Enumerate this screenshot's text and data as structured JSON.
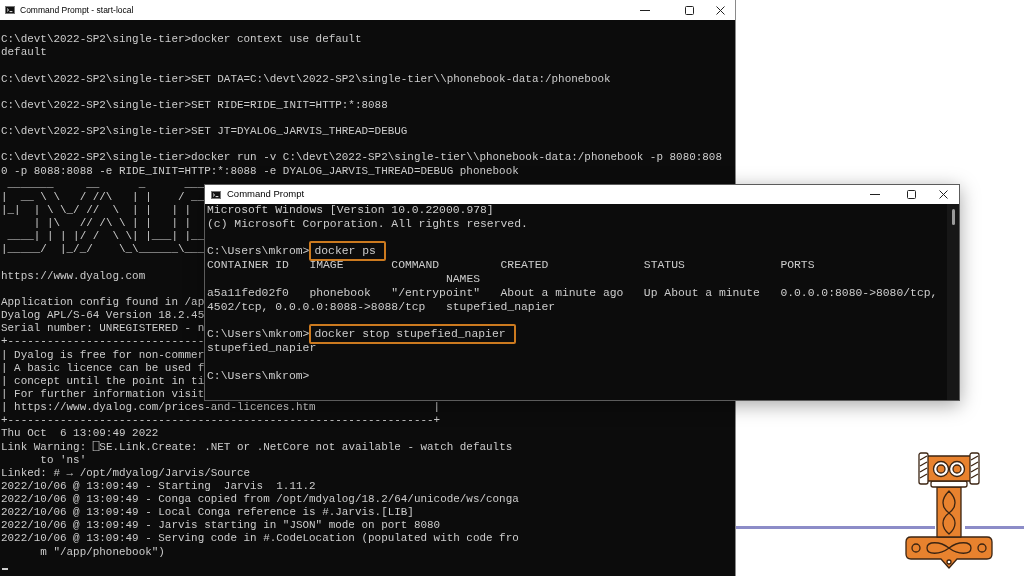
{
  "back_window": {
    "title": "Command Prompt - start-local",
    "cursor": true,
    "blocks": [
      [
        "C:\\devt\\2022-SP2\\single-tier>docker context use default",
        "default"
      ],
      [
        "C:\\devt\\2022-SP2\\single-tier>SET DATA=C:\\devt\\2022-SP2\\single-tier\\\\phonebook-data:/phonebook"
      ],
      [
        "C:\\devt\\2022-SP2\\single-tier>SET RIDE=RIDE_INIT=HTTP:*:8088"
      ],
      [
        "C:\\devt\\2022-SP2\\single-tier>SET JT=DYALOG_JARVIS_THREAD=DEBUG"
      ],
      [
        "C:\\devt\\2022-SP2\\single-tier>docker run -v C:\\devt\\2022-SP2\\single-tier\\\\phonebook-data:/phonebook -p 8080:808",
        "0 -p 8088:8088 -e RIDE_INIT=HTTP:*:8088 -e DYALOG_JARVIS_THREAD=DEBUG phonebook",
        " _______     __      _      ___",
        "|  __ \\ \\   / //\\   | |    / __",
        "|_|  | \\ \\_/ //  \\  | |   | |",
        "     | |\\   // /\\ \\ | |   | |",
        " ____| | | |/ /  \\ \\| |___| |__",
        "|_____/  |_/_/    \\_\\______\\___"
      ],
      [
        "https://www.dyalog.com"
      ],
      [
        "Application config found in /ap",
        "Dyalog APL/S-64 Version 18.2.45",
        "Serial number: UNREGISTERED - n",
        "+------------------------------",
        "| Dyalog is free for non-commer",
        "| A basic licence can be used f",
        "| concept until the point in ti",
        "| For further information visit",
        "| https://www.dyalog.com/prices-and-licences.htm                  |",
        "+-----------------------------------------------------------------+",
        "Thu Oct  6 13:09:49 2022",
        "Link Warning: ⎕SE.Link.Create: .NET or .NetCore not available - watch defaults",
        "      to 'ns'",
        "Linked: # → /opt/mdyalog/Jarvis/Source",
        "2022/10/06 @ 13:09:49 - Starting  Jarvis  1.11.2",
        "2022/10/06 @ 13:09:49 - Conga copied from /opt/mdyalog/18.2/64/unicode/ws/conga",
        "2022/10/06 @ 13:09:49 - Local Conga reference is #.Jarvis.[LIB]",
        "2022/10/06 @ 13:09:49 - Jarvis starting in \"JSON\" mode on port 8080",
        "2022/10/06 @ 13:09:49 - Serving code in #.CodeLocation (populated with code fro",
        "      m \"/app/phonebook\")"
      ]
    ]
  },
  "front_window": {
    "title": "Command Prompt",
    "blocks": [
      [
        {
          "kind": "output",
          "text": "Microsoft Windows [Version 10.0.22000.978]"
        },
        {
          "kind": "output",
          "text": "(c) Microsoft Corporation. All rights reserved."
        }
      ],
      [
        {
          "kind": "prompt",
          "prompt": "C:\\Users\\mkrom>",
          "command": "docker ps",
          "highlighted": true
        },
        {
          "kind": "output",
          "text": "CONTAINER ID   IMAGE       COMMAND         CREATED              STATUS              PORTS"
        },
        {
          "kind": "output",
          "text": "                                   NAMES"
        },
        {
          "kind": "output",
          "text": "a5a11fed02f0   phonebook   \"/entrypoint\"   About a minute ago   Up About a minute   0.0.0.0:8080->8080/tcp,"
        },
        {
          "kind": "output",
          "text": "4502/tcp, 0.0.0.0:8088->8088/tcp   stupefied_napier"
        }
      ],
      [
        {
          "kind": "prompt",
          "prompt": "C:\\Users\\mkrom>",
          "command": "docker stop stupefied_napier",
          "highlighted": true
        },
        {
          "kind": "output",
          "text": "stupefied_napier"
        }
      ],
      [
        {
          "kind": "output",
          "text": "C:\\Users\\mkrom>"
        }
      ]
    ]
  }
}
